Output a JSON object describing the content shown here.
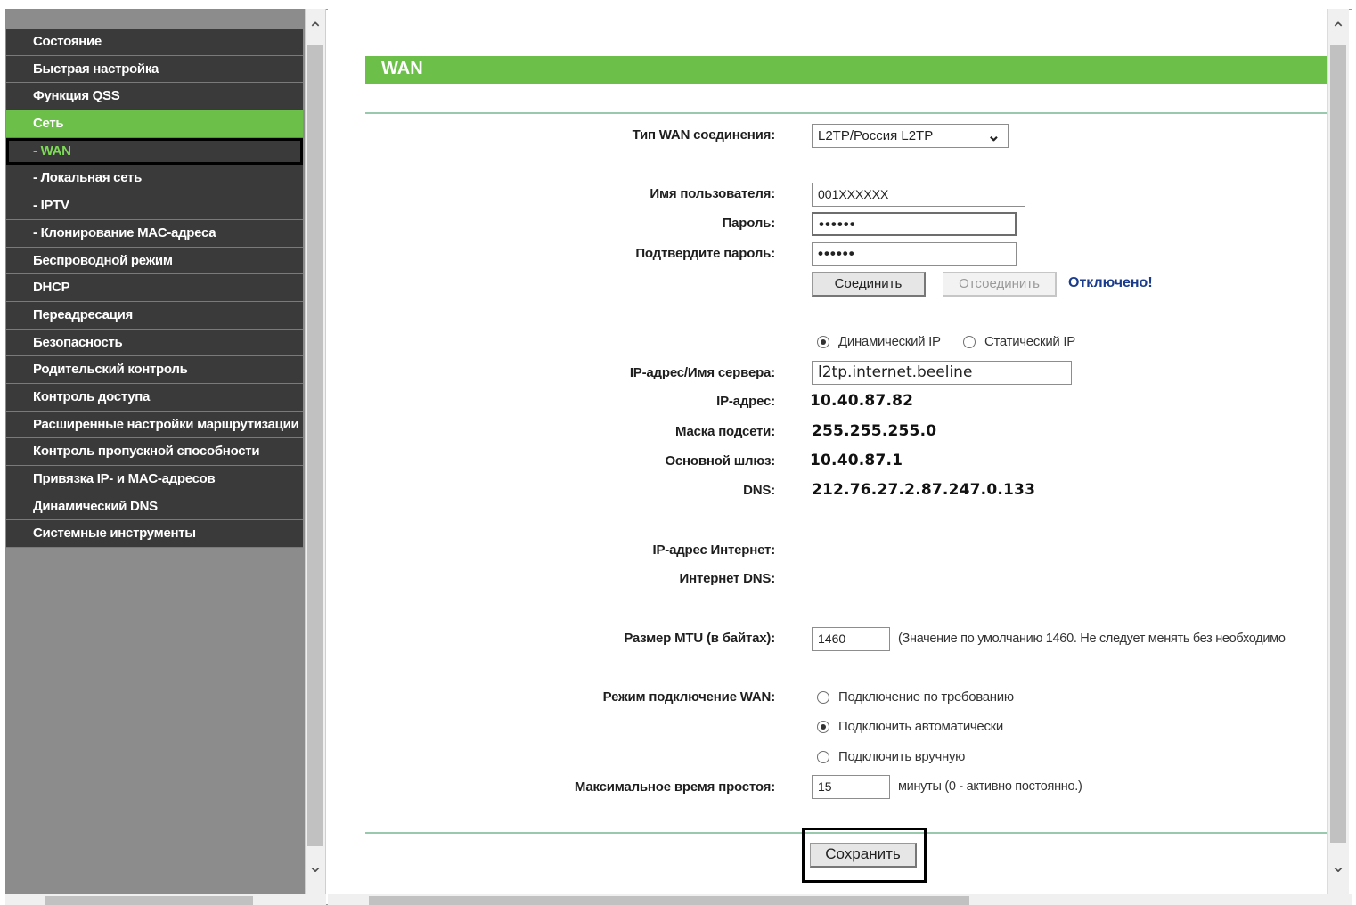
{
  "menu": {
    "items": [
      {
        "label": "Состояние"
      },
      {
        "label": "Быстрая настройка"
      },
      {
        "label": "Функция QSS"
      },
      {
        "label": "Сеть"
      },
      {
        "label": "- WAN"
      },
      {
        "label": "- Локальная сеть"
      },
      {
        "label": "- IPTV"
      },
      {
        "label": "- Клонирование MAC-адреса"
      },
      {
        "label": "Беспроводной режим"
      },
      {
        "label": "DHCP"
      },
      {
        "label": "Переадресация"
      },
      {
        "label": "Безопасность"
      },
      {
        "label": "Родительский контроль"
      },
      {
        "label": "Контроль доступа"
      },
      {
        "label": "Расширенные настройки маршрутизации"
      },
      {
        "label": "Контроль пропускной способности"
      },
      {
        "label": "Привязка IP- и MAC-адресов"
      },
      {
        "label": "Динамический DNS"
      },
      {
        "label": "Системные инструменты"
      }
    ]
  },
  "page": {
    "title": "WAN"
  },
  "form": {
    "wan_type_label": "Тип WAN соединения:",
    "wan_type_value": "L2TP/Россия L2TP",
    "username_label": "Имя пользователя:",
    "username_value": "001XXXXXX",
    "password_label": "Пароль:",
    "password_value": "••••••",
    "confirm_label": "Подтвердите пароль:",
    "confirm_value": "••••••",
    "connect_button": "Соединить",
    "disconnect_button": "Отсоединить",
    "status": "Отключено!",
    "ip_mode_dynamic": "Динамический IP",
    "ip_mode_static": "Статический IP",
    "server_label": "IP-адрес/Имя сервера:",
    "server_value": "l2tp.internet.beeline",
    "ip_label": "IP-адрес:",
    "ip_value": "10.40.87.82",
    "mask_label": "Маска подсети:",
    "mask_value": "255.255.255.0",
    "gateway_label": "Основной шлюз:",
    "gateway_value": "10.40.87.1",
    "dns_label": "DNS:",
    "dns_value": "212.76.27.2.87.247.0.133",
    "internet_ip_label": "IP-адрес Интернет:",
    "internet_dns_label": "Интернет DNS:",
    "mtu_label": "Размер MTU (в байтах):",
    "mtu_value": "1460",
    "mtu_note": "(Значение по умолчанию 1460. Не следует менять без необходимо",
    "mode_label": "Режим подключение WAN:",
    "mode_on_demand": "Подключение по требованию",
    "mode_auto": "Подключить автоматически",
    "mode_manual": "Подключить вручную",
    "idle_label": "Максимальное время простоя:",
    "idle_value": "15",
    "idle_note": "минуты (0 - активно постоянно.)",
    "save_button": "Сохранить"
  }
}
